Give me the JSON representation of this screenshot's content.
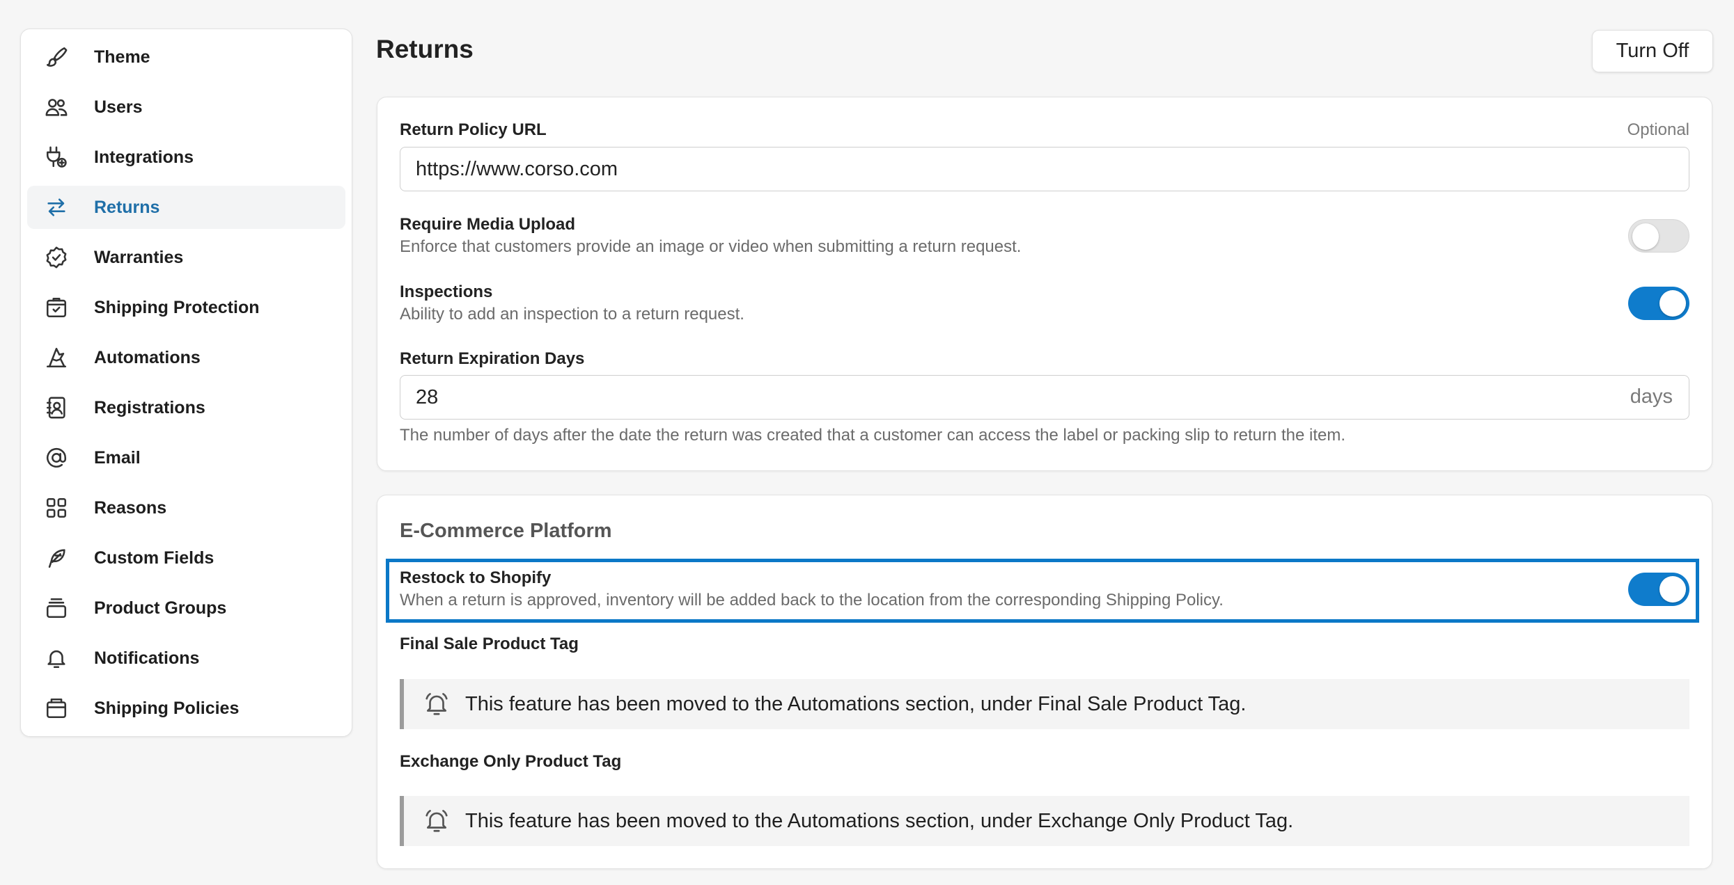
{
  "sidebar": {
    "items": [
      {
        "label": "Theme",
        "icon": "brush-icon"
      },
      {
        "label": "Users",
        "icon": "users-icon"
      },
      {
        "label": "Integrations",
        "icon": "plug-icon"
      },
      {
        "label": "Returns",
        "icon": "arrows-exchange-icon",
        "active": true
      },
      {
        "label": "Warranties",
        "icon": "badge-check-icon"
      },
      {
        "label": "Shipping Protection",
        "icon": "package-check-icon"
      },
      {
        "label": "Automations",
        "icon": "wizard-hat-icon"
      },
      {
        "label": "Registrations",
        "icon": "contact-card-icon"
      },
      {
        "label": "Email",
        "icon": "at-sign-icon"
      },
      {
        "label": "Reasons",
        "icon": "grid-icon"
      },
      {
        "label": "Custom Fields",
        "icon": "feather-icon"
      },
      {
        "label": "Product Groups",
        "icon": "stack-icon"
      },
      {
        "label": "Notifications",
        "icon": "bell-icon"
      },
      {
        "label": "Shipping Policies",
        "icon": "box-icon"
      }
    ]
  },
  "header": {
    "title": "Returns",
    "turn_off_label": "Turn Off"
  },
  "returns_card": {
    "policy_url": {
      "label": "Return Policy URL",
      "optional_label": "Optional",
      "value": "https://www.corso.com"
    },
    "media_upload": {
      "label": "Require Media Upload",
      "description": "Enforce that customers provide an image or video when submitting a return request.",
      "enabled": false
    },
    "inspections": {
      "label": "Inspections",
      "description": "Ability to add an inspection to a return request.",
      "enabled": true
    },
    "expiration": {
      "label": "Return Expiration Days",
      "value": "28",
      "suffix": "days",
      "help": "The number of days after the date the return was created that a customer can access the label or packing slip to return the item."
    }
  },
  "ecommerce_card": {
    "title": "E-Commerce Platform",
    "restock": {
      "label": "Restock to Shopify",
      "description": "When a return is approved, inventory will be added back to the location from the corresponding Shipping Policy.",
      "enabled": true
    },
    "final_sale": {
      "label": "Final Sale Product Tag",
      "notice": "This feature has been moved to the Automations section, under Final Sale Product Tag."
    },
    "exchange_only": {
      "label": "Exchange Only Product Tag",
      "notice": "This feature has been moved to the Automations section, under Exchange Only Product Tag."
    }
  },
  "colors": {
    "accent": "#0f7ccc",
    "active_nav_text": "#1f6fa8",
    "highlight_border": "#0b78c7"
  }
}
